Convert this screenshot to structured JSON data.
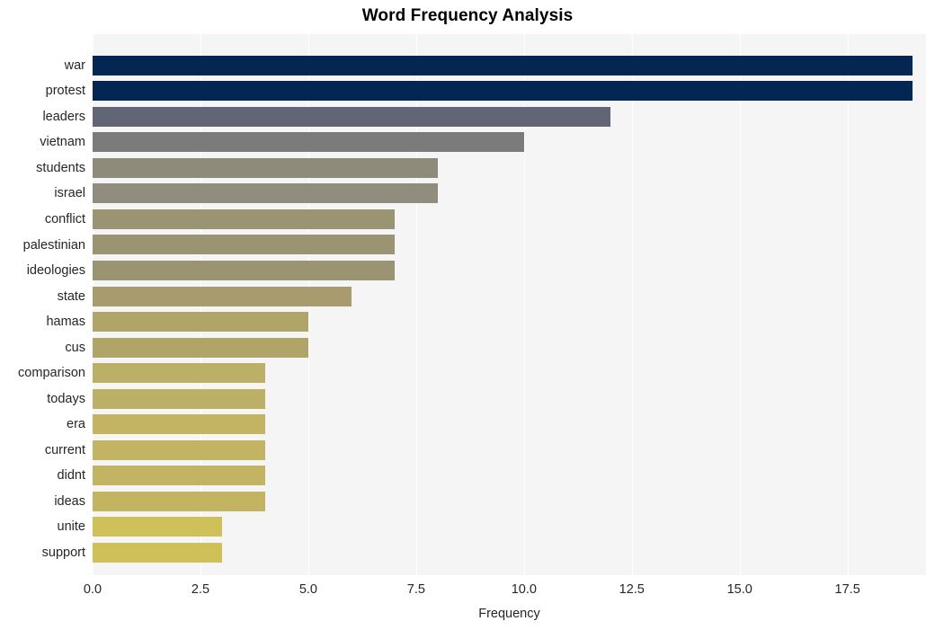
{
  "chart_data": {
    "type": "bar",
    "orientation": "horizontal",
    "title": "Word Frequency Analysis",
    "xlabel": "Frequency",
    "ylabel": "",
    "xlim": [
      0,
      19.32
    ],
    "grid": true,
    "legend": null,
    "categories": [
      "war",
      "protest",
      "leaders",
      "vietnam",
      "students",
      "israel",
      "conflict",
      "palestinian",
      "ideologies",
      "state",
      "hamas",
      "cus",
      "comparison",
      "todays",
      "era",
      "current",
      "didnt",
      "ideas",
      "unite",
      "support"
    ],
    "values": [
      19,
      19,
      12,
      10,
      8,
      8,
      7,
      7,
      7,
      6,
      5,
      5,
      4,
      4,
      4,
      4,
      4,
      4,
      3,
      3
    ],
    "bar_colors": [
      "#042652",
      "#042652",
      "#616575",
      "#7b7b7b",
      "#8e8b7b",
      "#918d7e",
      "#9b9472",
      "#9b9472",
      "#9b9472",
      "#a89c6e",
      "#b1a469",
      "#b1a469",
      "#bcaf66",
      "#bcaf66",
      "#c2b462",
      "#c2b462",
      "#c2b462",
      "#c3b462",
      "#cfc05a",
      "#cfc05a"
    ],
    "xticks": [
      0.0,
      2.5,
      5.0,
      7.5,
      10.0,
      12.5,
      15.0,
      17.5
    ],
    "xtick_labels": [
      "0.0",
      "2.5",
      "5.0",
      "7.5",
      "10.0",
      "12.5",
      "15.0",
      "17.5"
    ],
    "plot_bgcolor": "#f5f5f5",
    "gridline_color": "#ffffff",
    "figure_bgcolor": "#ffffff",
    "text_color": "#262626"
  }
}
